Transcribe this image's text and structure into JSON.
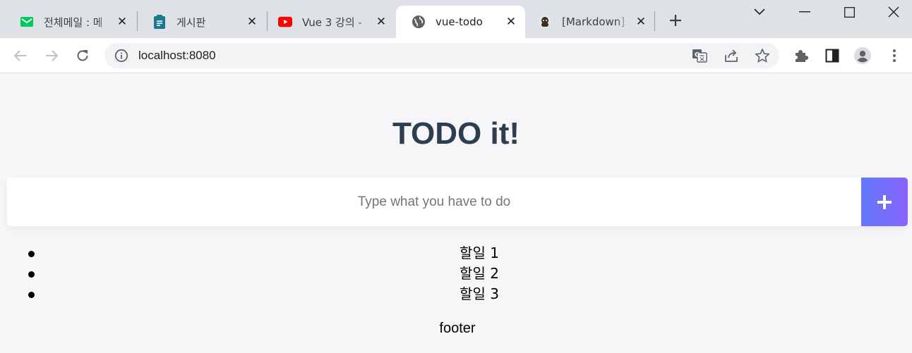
{
  "browser": {
    "tabs": [
      {
        "title": "전체메일 : 메",
        "icon": "mail-icon",
        "active": false
      },
      {
        "title": "게시판",
        "icon": "clipboard-icon",
        "active": false
      },
      {
        "title": "Vue 3 강의 -",
        "icon": "youtube-icon",
        "active": false
      },
      {
        "title": "vue-todo",
        "icon": "globe-icon",
        "active": true
      },
      {
        "title": "[Markdown]",
        "icon": "avatar-icon",
        "active": false
      }
    ],
    "url": "localhost:8080",
    "colors": {
      "tabstrip": "#dee1e6",
      "youtube": "#ff0000",
      "mail": "#03c75a",
      "clipboard": "#1a7a8a"
    }
  },
  "app": {
    "title": "TODO it!",
    "input_placeholder": "Type what you have to do",
    "add_icon": "plus-icon",
    "todos": [
      "할일 1",
      "할일 2",
      "할일 3"
    ],
    "footer": "footer",
    "colors": {
      "title": "#2c3e50",
      "button_gradient_start": "#6478fb",
      "button_gradient_end": "#8763fb",
      "background": "#f6f6f8"
    }
  }
}
